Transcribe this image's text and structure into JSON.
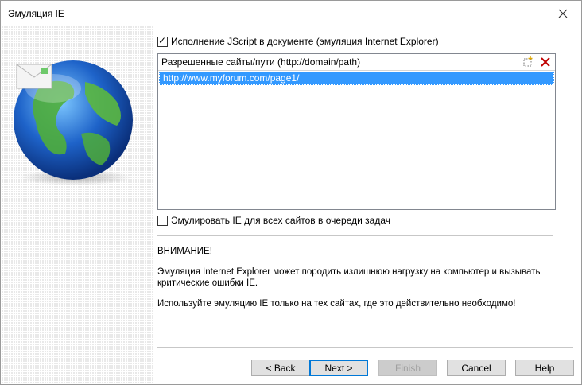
{
  "window": {
    "title": "Эмуляция IE"
  },
  "options": {
    "jscript_label": "Исполнение JScript в документе (эмуляция Internet Explorer)",
    "jscript_checked": true,
    "emulate_all_label": "Эмулировать IE для всех сайтов в очереди задач",
    "emulate_all_checked": false
  },
  "sites_list": {
    "header": "Разрешенные сайты/пути (http://domain/path)",
    "items": [
      "http://www.myforum.com/page1/"
    ]
  },
  "warning": {
    "title": "ВНИМАНИЕ!",
    "line1": "Эмуляция Internet Explorer может породить излишнюю нагрузку на компьютер и вызывать",
    "line2": "критические ошибки IE.",
    "line3": "Используйте эмуляцию IE только на тех сайтах, где это действительно необходимо!"
  },
  "buttons": {
    "back": "< Back",
    "next": "Next >",
    "finish": "Finish",
    "cancel": "Cancel",
    "help": "Help"
  }
}
